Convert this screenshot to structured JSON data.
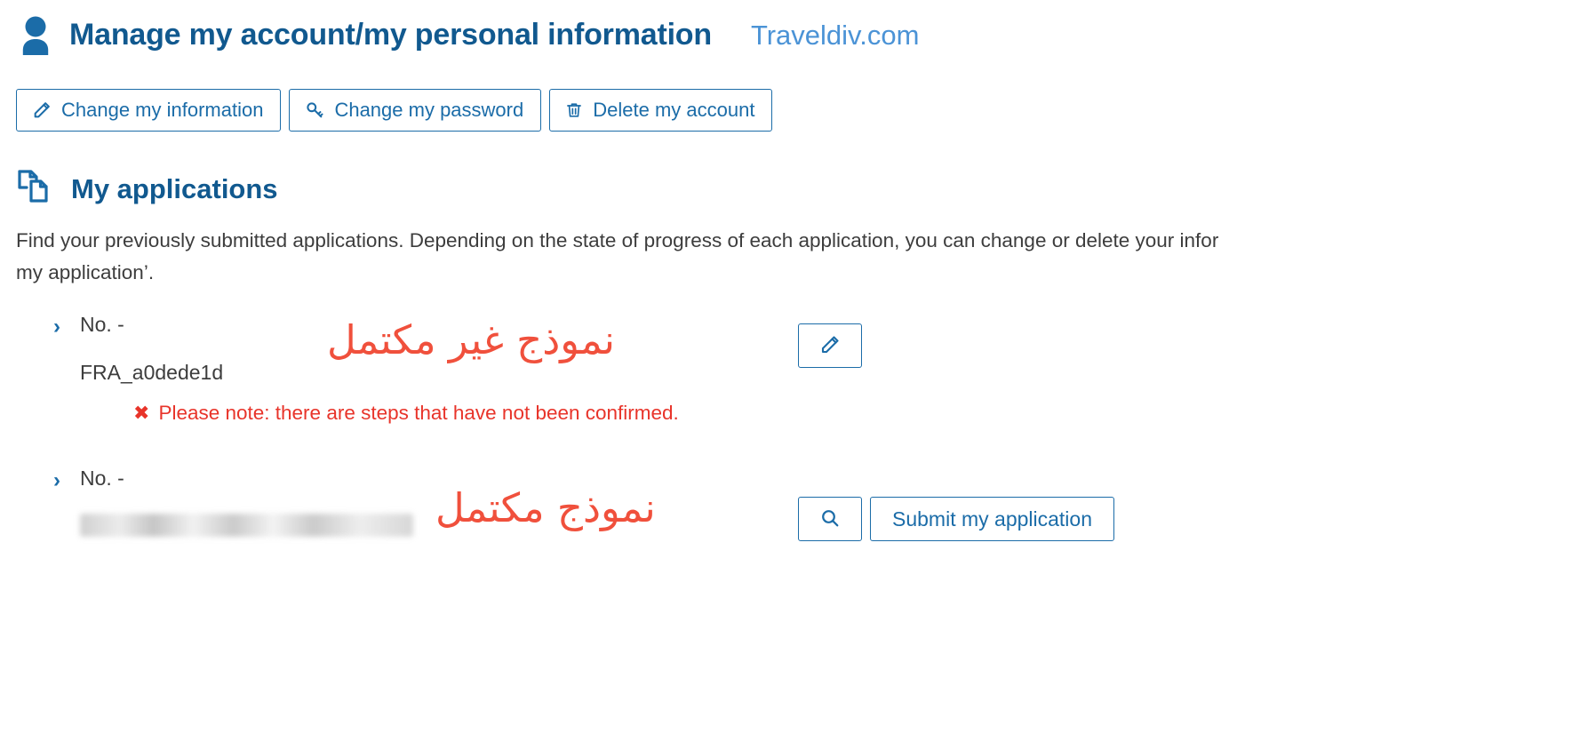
{
  "header": {
    "user_icon": "user-icon",
    "title": "Manage my account/my personal information",
    "brand": "Traveldiv.com",
    "title_color": "#11598f",
    "brand_color": "#4b93d6"
  },
  "actions": [
    {
      "icon": "pencil-icon",
      "label": "Change my information"
    },
    {
      "icon": "key-icon",
      "label": "Change my password"
    },
    {
      "icon": "trash-icon",
      "label": "Delete my account"
    }
  ],
  "applications_section": {
    "icon": "copy-documents-icon",
    "title": "My applications",
    "description_line1": "Find your previously submitted applications. Depending on the state of progress of each application, you can change or delete your infor",
    "description_line2": "my application’."
  },
  "applications": [
    {
      "chevron": "chevron-right-icon",
      "number_label": "No. -",
      "reference": "FRA_a0dede1d",
      "redacted": false,
      "annotation": "نموذج غير مكتمل",
      "annotation_color": "#f0503c",
      "alert": {
        "marker": "✖",
        "text": "Please note: there are steps that have not been confirmed.",
        "color": "#e8342a"
      },
      "buttons": [
        {
          "icon": "pencil-icon",
          "label": "",
          "type": "icon"
        }
      ]
    },
    {
      "chevron": "chevron-right-icon",
      "number_label": "No. -",
      "reference": "",
      "redacted": true,
      "annotation": "نموذج مكتمل",
      "annotation_color": "#f0503c",
      "alert": null,
      "buttons": [
        {
          "icon": "search-icon",
          "label": "",
          "type": "icon"
        },
        {
          "icon": "",
          "label": "Submit my application",
          "type": "text"
        }
      ]
    }
  ],
  "theme": {
    "primary_blue": "#1b6ca8",
    "dark_blue": "#11598f",
    "light_blue": "#4b93d6",
    "red": "#e8342a",
    "annotation_red": "#f0503c",
    "body_text": "#3d3d3d",
    "background": "#ffffff"
  }
}
